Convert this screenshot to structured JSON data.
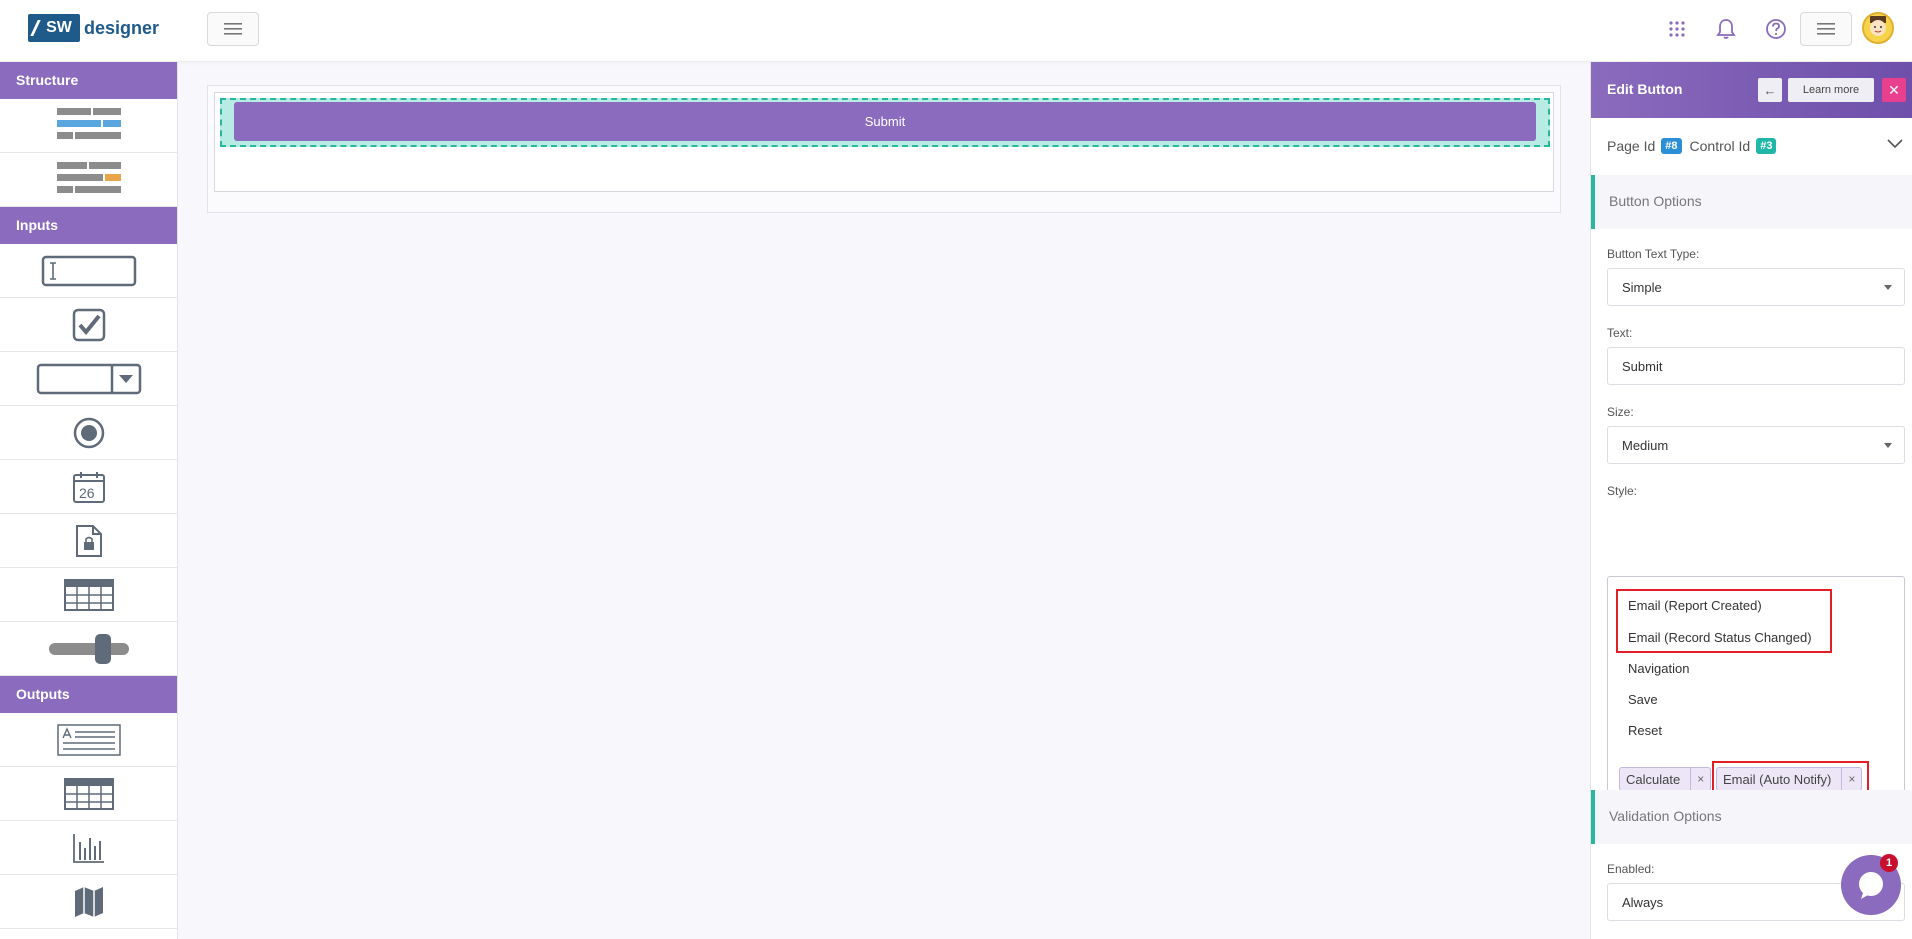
{
  "header": {
    "logo_mark": "SW",
    "logo_text": "designer",
    "icons": [
      "hamburger-icon",
      "apps-grid-icon",
      "bell-icon",
      "help-icon",
      "menu-icon",
      "avatar"
    ]
  },
  "sidebar": {
    "sections": [
      {
        "title": "Structure",
        "tools": [
          "columns-layout-icon",
          "columns-layout-highlight-icon"
        ]
      },
      {
        "title": "Inputs",
        "tools": [
          "text-input-icon",
          "checkbox-icon",
          "dropdown-icon",
          "radio-icon",
          "calendar-icon",
          "file-upload-icon",
          "grid-input-icon",
          "slider-icon"
        ]
      },
      {
        "title": "Outputs",
        "tools": [
          "text-block-icon",
          "table-icon",
          "bar-chart-icon",
          "map-icon"
        ]
      }
    ],
    "calendar_day": "26"
  },
  "canvas": {
    "button_label": "Submit"
  },
  "panel": {
    "title": "Edit Button",
    "back_glyph": "←",
    "learn_more": "Learn more",
    "close_glyph": "✕",
    "page_id_label": "Page Id",
    "page_id": "#8",
    "control_id_label": "Control Id",
    "control_id": "#3",
    "button_options": "Button Options",
    "text_type_label": "Button Text Type:",
    "text_type_value": "Simple",
    "text_label": "Text:",
    "text_value": "Submit",
    "size_label": "Size:",
    "size_value": "Medium",
    "style_label": "Style:",
    "style_options": [
      "Email (Report Created)",
      "Email (Record Status Changed)",
      "Navigation",
      "Save",
      "Reset"
    ],
    "selected_tags": [
      "Calculate",
      "Email (Auto Notify)"
    ],
    "tag_remove_glyph": "×",
    "validation_options": "Validation Options",
    "enabled_label": "Enabled:",
    "enabled_value": "Always"
  },
  "chat": {
    "badge_count": "1"
  },
  "colors": {
    "brand_purple": "#8a6bbd",
    "accent_teal": "#2ab7a0",
    "highlight_red": "#e41e26",
    "close_pink": "#e8408e"
  }
}
